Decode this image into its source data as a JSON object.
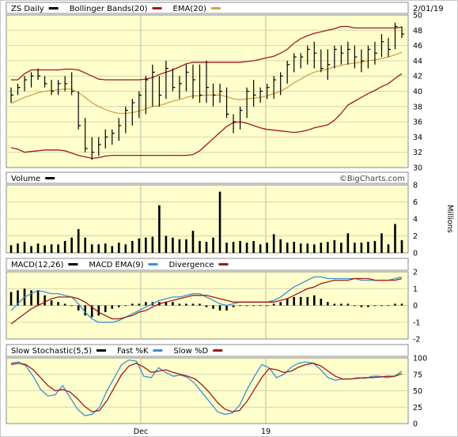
{
  "chart_data": [
    {
      "type": "line",
      "name": "price",
      "title": "ZS Daily",
      "date_label": "2/01/19",
      "legend": [
        {
          "label": "ZS Daily",
          "color": "#000000"
        },
        {
          "label": "Bollinger Bands(20)",
          "color": "#a01818"
        },
        {
          "label": "EMA(20)",
          "color": "#d4a24a"
        }
      ],
      "ylim": [
        30,
        50
      ],
      "yticks": [
        30,
        32,
        34,
        36,
        38,
        40,
        42,
        44,
        46,
        48,
        50
      ],
      "x": [
        1,
        2,
        3,
        4,
        5,
        6,
        7,
        8,
        9,
        10,
        11,
        12,
        13,
        14,
        15,
        16,
        17,
        18,
        19,
        20,
        21,
        22,
        23,
        24,
        25,
        26,
        27,
        28,
        29,
        30,
        31,
        32,
        33,
        34,
        35,
        36,
        37,
        38,
        39,
        40,
        41,
        42,
        43,
        44,
        45,
        46,
        47,
        48,
        49,
        50,
        51,
        52,
        53,
        54,
        55,
        56,
        57,
        58,
        59,
        60,
        61,
        62,
        63,
        64,
        65,
        66,
        67,
        68,
        69,
        70,
        71,
        72,
        73,
        74,
        75,
        76,
        77,
        78,
        79,
        80,
        81,
        82,
        83,
        84,
        85,
        86,
        87,
        88,
        89,
        90,
        91,
        92,
        93,
        94,
        95,
        96,
        97,
        98,
        99,
        100,
        101,
        102,
        103,
        104,
        105,
        106,
        107,
        108,
        109,
        110,
        111,
        112,
        113,
        114,
        115,
        116,
        117,
        118,
        119,
        120,
        121,
        122,
        123,
        124
      ],
      "price_bars": {
        "high": [
          40.5,
          41.0,
          42.0,
          42.5,
          43.0,
          42.0,
          41.5,
          41.5,
          42.0,
          42.5,
          40.0,
          36.5,
          34.0,
          34.0,
          35.0,
          35.0,
          36.5,
          38.0,
          39.0,
          40.0,
          42.0,
          43.5,
          42.0,
          44.0,
          43.0,
          42.0,
          43.5,
          43.5,
          43.5,
          44.0,
          41.0,
          41.0,
          40.5,
          37.0,
          38.0,
          40.5,
          41.5,
          40.5,
          41.0,
          42.0,
          42.5,
          44.0,
          45.0,
          45.0,
          46.0,
          46.5,
          45.5,
          45.5,
          46.0,
          46.0,
          46.5,
          46.0,
          45.5,
          46.0,
          46.5,
          47.5,
          47.0,
          49.0,
          48.5
        ],
        "low": [
          38.5,
          39.5,
          40.0,
          40.5,
          41.5,
          40.5,
          39.5,
          39.5,
          40.0,
          39.5,
          35.0,
          32.0,
          31.0,
          31.5,
          32.5,
          33.0,
          33.5,
          34.5,
          35.5,
          36.5,
          37.0,
          38.0,
          38.0,
          39.0,
          40.0,
          39.0,
          40.0,
          39.0,
          38.5,
          38.5,
          38.0,
          38.5,
          36.5,
          34.5,
          35.0,
          36.5,
          38.0,
          38.5,
          39.0,
          39.0,
          39.5,
          41.0,
          42.5,
          43.0,
          43.5,
          43.0,
          42.5,
          41.5,
          43.0,
          43.5,
          43.5,
          43.0,
          42.5,
          43.0,
          43.5,
          44.5,
          44.5,
          45.5,
          47.0
        ],
        "close": [
          39.5,
          40.5,
          41.5,
          42.0,
          42.0,
          41.0,
          40.0,
          41.0,
          41.0,
          40.0,
          35.5,
          32.5,
          32.0,
          33.0,
          34.0,
          34.5,
          35.5,
          37.5,
          38.5,
          39.5,
          41.5,
          42.5,
          39.5,
          43.0,
          40.5,
          41.0,
          42.5,
          41.5,
          39.5,
          40.5,
          39.5,
          40.0,
          37.0,
          36.0,
          37.5,
          40.0,
          39.5,
          40.0,
          40.5,
          41.5,
          42.0,
          43.5,
          44.5,
          44.5,
          45.5,
          45.0,
          43.0,
          43.5,
          45.5,
          45.0,
          45.5,
          44.5,
          44.0,
          45.5,
          45.0,
          46.5,
          45.5,
          48.5,
          47.5
        ]
      },
      "series": [
        {
          "name": "Bollinger Bands(20)",
          "color": "#a01818",
          "values": [
            41.5,
            41.5,
            42.3,
            42.8,
            42.8,
            42.8,
            42.8,
            42.8,
            42.9,
            42.9,
            42.8,
            42.4,
            42.0,
            41.6,
            41.5,
            41.5,
            41.5,
            41.5,
            41.5,
            41.5,
            41.6,
            41.8,
            42.2,
            42.5,
            42.8,
            43.2,
            43.6,
            43.8,
            43.8,
            43.8,
            43.8,
            43.8,
            43.8,
            43.8,
            43.8,
            43.9,
            44.0,
            44.2,
            44.4,
            44.6,
            45.0,
            45.5,
            46.3,
            46.9,
            47.3,
            47.6,
            47.8,
            48.0,
            48.2,
            48.5,
            48.5,
            48.3,
            48.3,
            48.3,
            48.3,
            48.3,
            48.3,
            48.3,
            48.4
          ]
        },
        {
          "name": "Bollinger Bands(20)",
          "color": "#a01818",
          "values": [
            32.6,
            32.4,
            32.0,
            32.1,
            32.2,
            32.3,
            32.3,
            32.3,
            32.2,
            31.9,
            31.6,
            31.4,
            31.2,
            31.3,
            31.5,
            31.6,
            31.6,
            31.6,
            31.6,
            31.6,
            31.6,
            31.6,
            31.6,
            31.6,
            31.6,
            31.6,
            31.6,
            31.7,
            32.2,
            33.0,
            33.8,
            34.6,
            35.4,
            35.9,
            36.0,
            35.8,
            35.5,
            35.2,
            35.0,
            34.9,
            34.8,
            34.7,
            34.6,
            34.7,
            34.9,
            35.2,
            35.4,
            35.6,
            36.2,
            37.1,
            38.2,
            38.7,
            39.2,
            39.7,
            40.1,
            40.6,
            41.0,
            41.7,
            42.3
          ]
        },
        {
          "name": "EMA(20)",
          "color": "#d4a24a",
          "values": [
            38.4,
            38.8,
            39.2,
            39.5,
            39.8,
            40.0,
            40.1,
            40.2,
            40.3,
            40.3,
            39.8,
            39.2,
            38.5,
            38.0,
            37.6,
            37.3,
            37.1,
            37.1,
            37.2,
            37.4,
            37.7,
            38.0,
            38.1,
            38.4,
            38.7,
            38.9,
            39.2,
            39.4,
            39.4,
            39.5,
            39.5,
            39.5,
            39.3,
            39.0,
            38.9,
            39.0,
            39.1,
            39.2,
            39.4,
            39.7,
            40.0,
            40.5,
            41.1,
            41.6,
            42.1,
            42.5,
            42.7,
            42.9,
            43.2,
            43.4,
            43.6,
            43.7,
            43.8,
            44.0,
            44.1,
            44.3,
            44.5,
            44.8,
            45.1
          ]
        }
      ],
      "watermark": "©BigCharts.com"
    },
    {
      "type": "bar",
      "name": "volume",
      "title": "Volume",
      "ylabel": "Millions",
      "ylim": [
        0,
        8
      ],
      "yticks": [
        0,
        2,
        4,
        6,
        8
      ],
      "values": [
        0.9,
        1.1,
        1.3,
        0.8,
        1.1,
        0.9,
        1.0,
        1.0,
        1.4,
        1.8,
        2.8,
        1.8,
        1.0,
        1.0,
        1.1,
        0.8,
        1.2,
        1.0,
        1.4,
        1.7,
        1.8,
        1.9,
        5.6,
        2.0,
        1.8,
        1.6,
        1.6,
        2.6,
        1.4,
        1.3,
        1.8,
        7.2,
        1.2,
        1.3,
        1.4,
        1.2,
        1.4,
        1.0,
        1.2,
        2.2,
        1.6,
        1.2,
        1.3,
        1.1,
        1.1,
        1.0,
        1.2,
        1.3,
        1.5,
        1.2,
        2.3,
        1.2,
        1.2,
        1.3,
        1.4,
        2.3,
        1.0,
        3.4,
        1.5
      ]
    },
    {
      "type": "line",
      "name": "macd",
      "title": "MACD",
      "legend": [
        {
          "label": "MACD(12,26)",
          "color": "#000000"
        },
        {
          "label": "MACD EMA(9)",
          "color": "#3a8fd6"
        },
        {
          "label": "Divergence",
          "color": "#a01818"
        }
      ],
      "ylim": [
        -2,
        2
      ],
      "yticks": [
        -2,
        -1,
        0,
        1,
        2
      ],
      "series": [
        {
          "name": "MACD(12,26)",
          "color": "#3a8fd6",
          "values": [
            -0.3,
            0.1,
            0.5,
            0.7,
            0.9,
            0.8,
            0.7,
            0.7,
            0.6,
            0.5,
            0.1,
            -0.4,
            -0.8,
            -1.0,
            -1.0,
            -1.0,
            -0.9,
            -0.7,
            -0.5,
            -0.3,
            -0.1,
            0.1,
            0.3,
            0.4,
            0.5,
            0.5,
            0.6,
            0.7,
            0.7,
            0.5,
            0.3,
            0.1,
            0.0,
            0.1,
            0.2,
            0.2,
            0.2,
            0.2,
            0.2,
            0.3,
            0.5,
            0.8,
            1.1,
            1.3,
            1.5,
            1.7,
            1.7,
            1.6,
            1.6,
            1.6,
            1.6,
            1.6,
            1.5,
            1.5,
            1.5,
            1.5,
            1.5,
            1.6,
            1.7
          ]
        },
        {
          "name": "MACD EMA(9)",
          "color": "#a01818",
          "values": [
            -1.1,
            -0.8,
            -0.5,
            -0.2,
            0.0,
            0.2,
            0.4,
            0.5,
            0.5,
            0.5,
            0.4,
            0.2,
            -0.1,
            -0.4,
            -0.6,
            -0.8,
            -0.8,
            -0.7,
            -0.6,
            -0.4,
            -0.3,
            -0.1,
            0.1,
            0.2,
            0.3,
            0.4,
            0.5,
            0.6,
            0.6,
            0.6,
            0.5,
            0.4,
            0.3,
            0.2,
            0.2,
            0.2,
            0.2,
            0.2,
            0.2,
            0.2,
            0.3,
            0.4,
            0.6,
            0.8,
            1.0,
            1.1,
            1.3,
            1.4,
            1.5,
            1.5,
            1.5,
            1.6,
            1.6,
            1.6,
            1.5,
            1.5,
            1.5,
            1.5,
            1.6
          ]
        },
        {
          "name": "Divergence",
          "color": "#000000",
          "values": [
            0.8,
            0.9,
            1.0,
            0.9,
            0.9,
            0.6,
            0.3,
            0.2,
            0.1,
            0.0,
            -0.3,
            -0.6,
            -0.7,
            -0.6,
            -0.4,
            -0.2,
            -0.1,
            0.0,
            0.1,
            0.1,
            0.2,
            0.2,
            0.2,
            0.2,
            0.2,
            0.1,
            0.1,
            0.1,
            0.1,
            -0.1,
            -0.2,
            -0.3,
            -0.3,
            -0.1,
            0.0,
            0.0,
            0.0,
            0.0,
            0.0,
            0.1,
            0.2,
            0.4,
            0.5,
            0.5,
            0.5,
            0.6,
            0.4,
            0.2,
            0.1,
            0.1,
            0.1,
            0.0,
            -0.1,
            -0.1,
            0.0,
            0.0,
            0.0,
            0.1,
            0.1
          ]
        }
      ]
    },
    {
      "type": "line",
      "name": "stochastic",
      "title": "Slow Stochastic(5,5)",
      "legend": [
        {
          "label": "Slow Stochastic(5,5)",
          "color": "#000000"
        },
        {
          "label": "Fast %K",
          "color": "#3a8fd6"
        },
        {
          "label": "Slow %D",
          "color": "#a01818"
        }
      ],
      "ylim": [
        0,
        100
      ],
      "yticks": [
        0,
        25,
        50,
        75,
        100
      ],
      "series": [
        {
          "name": "Fast %K",
          "color": "#3a8fd6",
          "values": [
            92,
            94,
            88,
            72,
            52,
            42,
            44,
            58,
            40,
            22,
            12,
            14,
            25,
            50,
            70,
            90,
            97,
            95,
            72,
            70,
            85,
            78,
            72,
            74,
            70,
            60,
            46,
            32,
            18,
            14,
            16,
            28,
            52,
            72,
            90,
            85,
            70,
            75,
            86,
            92,
            94,
            92,
            82,
            70,
            66,
            68,
            68,
            70,
            69,
            72,
            72,
            70,
            72,
            80
          ]
        },
        {
          "name": "Slow %D",
          "color": "#a01818",
          "values": [
            90,
            92,
            90,
            82,
            70,
            58,
            50,
            52,
            48,
            38,
            26,
            18,
            20,
            35,
            55,
            75,
            88,
            92,
            86,
            78,
            80,
            82,
            78,
            75,
            72,
            68,
            58,
            46,
            32,
            22,
            18,
            20,
            34,
            52,
            70,
            84,
            82,
            78,
            80,
            86,
            90,
            92,
            88,
            80,
            72,
            68,
            68,
            69,
            70,
            70,
            71,
            72,
            72,
            76
          ]
        }
      ]
    }
  ],
  "x_axis": {
    "ticks": [
      "Dec",
      "19"
    ]
  }
}
